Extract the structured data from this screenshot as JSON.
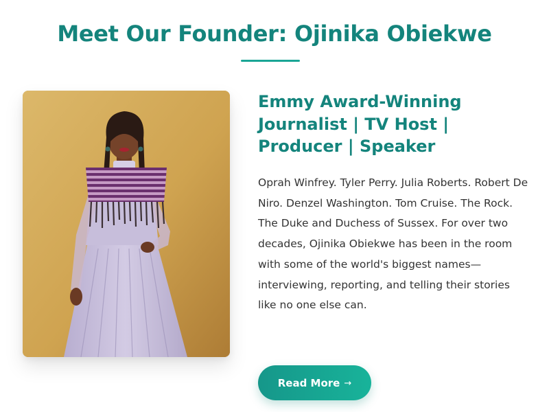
{
  "page": {
    "title": "Meet Our Founder: Ojinika Obiekwe"
  },
  "founder": {
    "headline": "Emmy Award-Winning Journalist | TV Host | Producer | Speaker",
    "bio": "Oprah Winfrey. Tyler Perry. Julia Roberts. Robert De Niro. Denzel Washington. Tom Cruise. The Rock. The Duke and Duchess of Sussex. For over two decades, Ojinika Obiekwe has been in the room with some of the world's biggest names—interviewing, reporting, and telling their stories like no one else can.",
    "photo_alt": "Portrait of Ojinika Obiekwe in a lavender pleated dress with a purple striped fringed cape",
    "read_more_label": "Read More",
    "read_more_arrow": "→"
  },
  "colors": {
    "accent": "#14847c",
    "button_gradient_start": "#16978a",
    "button_gradient_end": "#18b39a",
    "body_text": "#333333",
    "photo_background": "#cfa452"
  },
  "icons": {
    "read_more_arrow": "arrow-right-icon"
  }
}
